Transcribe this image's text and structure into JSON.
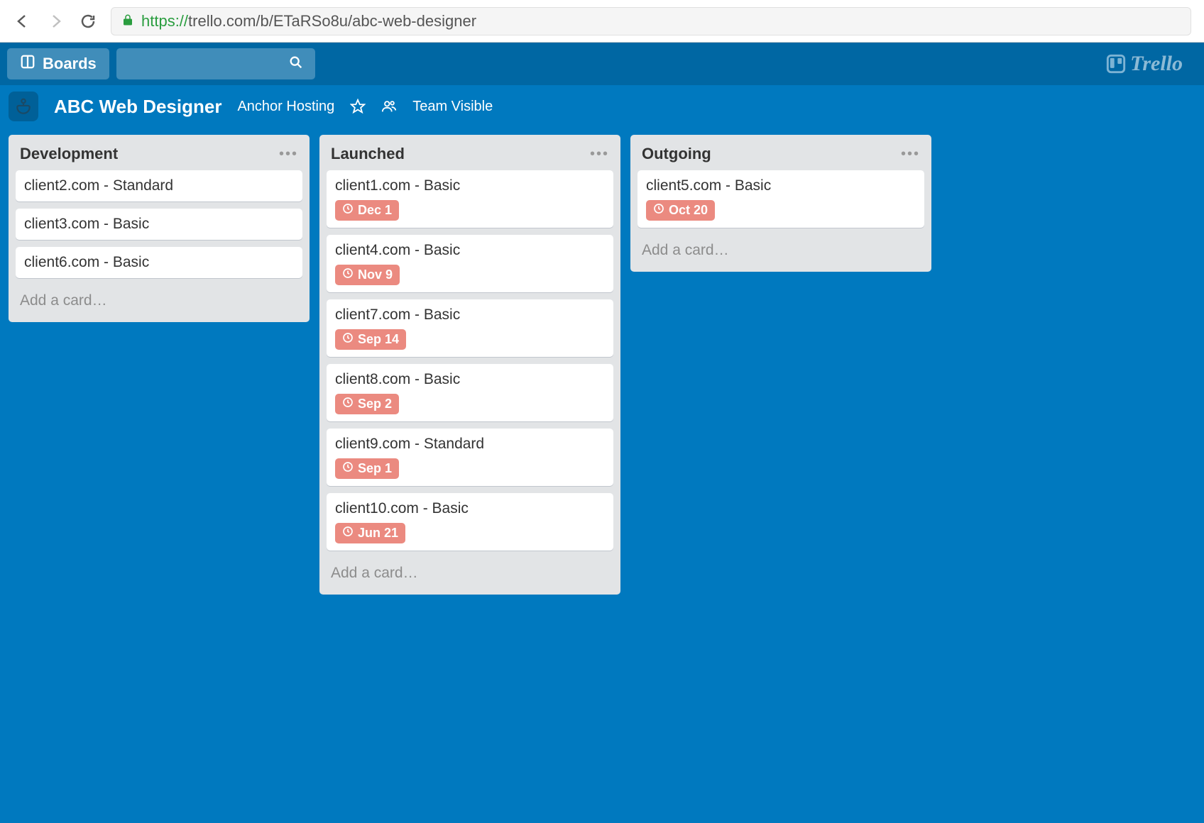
{
  "browser": {
    "url_proto": "https://",
    "url_rest": "trello.com/b/ETaRSo8u/abc-web-designer"
  },
  "header": {
    "boards_label": "Boards",
    "logo_text": "Trello"
  },
  "board": {
    "title": "ABC Web Designer",
    "org": "Anchor Hosting",
    "visibility": "Team Visible"
  },
  "lists": [
    {
      "title": "Development",
      "add_label": "Add a card…",
      "cards": [
        {
          "title": "client2.com - Standard",
          "due": null
        },
        {
          "title": "client3.com - Basic",
          "due": null
        },
        {
          "title": "client6.com - Basic",
          "due": null
        }
      ]
    },
    {
      "title": "Launched",
      "add_label": "Add a card…",
      "cards": [
        {
          "title": "client1.com - Basic",
          "due": "Dec 1"
        },
        {
          "title": "client4.com - Basic",
          "due": "Nov 9"
        },
        {
          "title": "client7.com - Basic",
          "due": "Sep 14"
        },
        {
          "title": "client8.com - Basic",
          "due": "Sep 2"
        },
        {
          "title": "client9.com - Standard",
          "due": "Sep 1"
        },
        {
          "title": "client10.com - Basic",
          "due": "Jun 21"
        }
      ]
    },
    {
      "title": "Outgoing",
      "add_label": "Add a card…",
      "cards": [
        {
          "title": "client5.com - Basic",
          "due": "Oct 20"
        }
      ]
    }
  ]
}
